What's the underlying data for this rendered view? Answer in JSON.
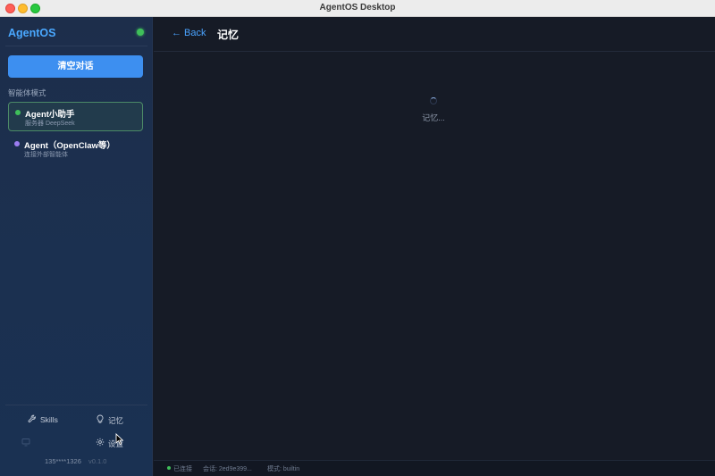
{
  "window": {
    "title": "AgentOS Desktop"
  },
  "sidebar": {
    "brand": "AgentOS",
    "clear_button": "清空对话",
    "section_label": "智能体模式",
    "agents": [
      {
        "name": "Agent小助手",
        "subtitle": "服务器 DeepSeek",
        "dot_color": "#3fbf5a",
        "active": true
      },
      {
        "name": "Agent（OpenClaw等）",
        "subtitle": "连接外部智能体",
        "dot_color": "#9b7cf0",
        "active": false
      }
    ],
    "nav": {
      "skills": "Skills",
      "memory": "记忆",
      "unknown": "",
      "settings": "设置"
    },
    "footer": {
      "user": "135****1326",
      "version": "v0.1.0"
    }
  },
  "main": {
    "back": "← Back",
    "title": "记忆",
    "loading": "记忆..."
  },
  "status": {
    "connected": "已连接",
    "session": "会话: 2ed9e399...",
    "mode": "模式: builtin"
  },
  "colors": {
    "accent": "#3d8ff0",
    "brand": "#4aa8ff",
    "online": "#3fbf5a",
    "agent2": "#9b7cf0"
  }
}
